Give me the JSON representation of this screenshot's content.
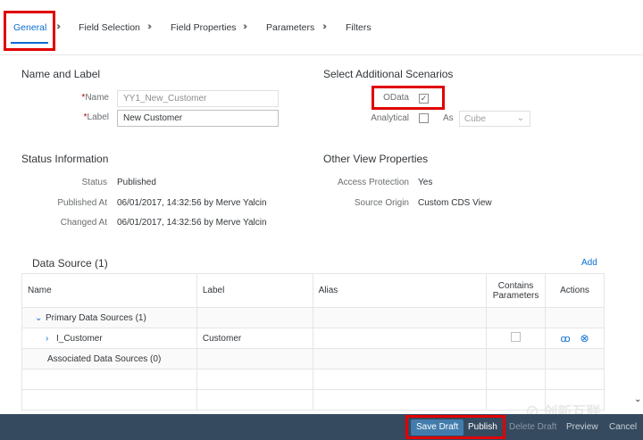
{
  "tabs": [
    {
      "label": "General"
    },
    {
      "label": "Field Selection"
    },
    {
      "label": "Field Properties"
    },
    {
      "label": "Parameters"
    },
    {
      "label": "Filters"
    }
  ],
  "name_label": {
    "title": "Name and Label",
    "name_label": "Name",
    "name_value": "YY1_New_Customer",
    "label_label": "Label",
    "label_value": "New Customer"
  },
  "scenarios": {
    "title": "Select Additional Scenarios",
    "odata_label": "OData",
    "odata_checked": "✓",
    "analytical_label": "Analytical",
    "as_label": "As",
    "as_value": "Cube"
  },
  "status_info": {
    "title": "Status Information",
    "status_label": "Status",
    "status_value": "Published",
    "published_at_label": "Published At",
    "published_at_value": "06/01/2017, 14:32:56 by Merve Yalcin",
    "changed_at_label": "Changed At",
    "changed_at_value": "06/01/2017, 14:32:56 by Merve Yalcin"
  },
  "other_view": {
    "title": "Other View Properties",
    "access_label": "Access Protection",
    "access_value": "Yes",
    "origin_label": "Source Origin",
    "origin_value": "Custom CDS View"
  },
  "data_source": {
    "title": "Data Source (1)",
    "add_label": "Add",
    "columns": {
      "name": "Name",
      "label": "Label",
      "alias": "Alias",
      "contains_1": "Contains",
      "contains_2": "Parameters",
      "actions": "Actions"
    },
    "primary_group": "Primary Data Sources (1)",
    "row_name": "I_Customer",
    "row_label": "Customer",
    "associated_group": "Associated Data Sources (0)"
  },
  "footer": {
    "save_draft": "Save Draft",
    "publish": "Publish",
    "delete_draft": "Delete Draft",
    "preview": "Preview",
    "cancel": "Cancel"
  },
  "watermark": "创新互联",
  "colors": {
    "accent": "#0a6ed1",
    "highlight_box": "#e00000",
    "footer_bg": "#354a5f",
    "primary_button": "#427cac"
  }
}
